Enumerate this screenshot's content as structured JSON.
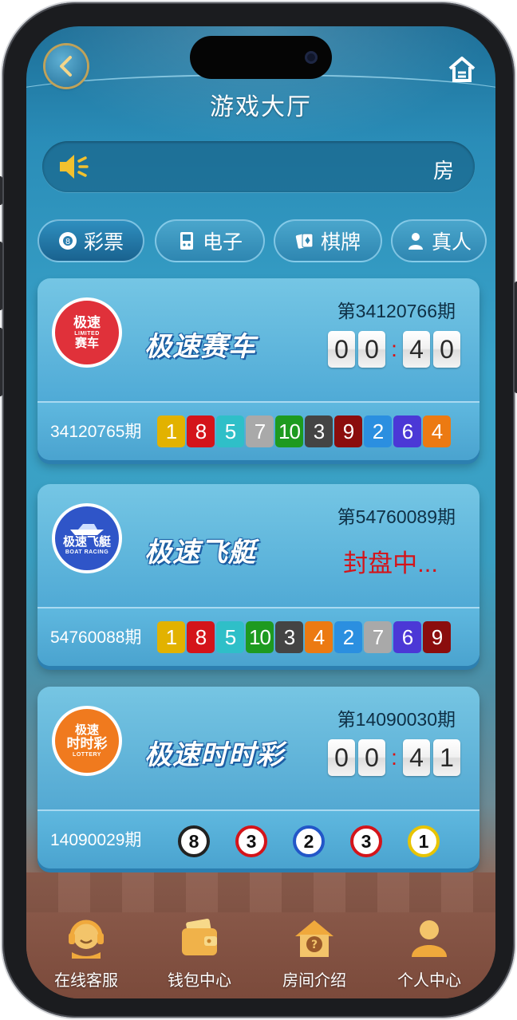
{
  "header": {
    "title": "游戏大厅"
  },
  "notice": {
    "text": "房"
  },
  "tabs": [
    {
      "label": "彩票",
      "icon": "ball-8-icon",
      "active": true
    },
    {
      "label": "电子",
      "icon": "handheld-console-icon"
    },
    {
      "label": "棋牌",
      "icon": "playing-cards-icon"
    },
    {
      "label": "真人",
      "icon": "person-icon"
    }
  ],
  "games": [
    {
      "logo": {
        "l1": "极速",
        "l2": "赛车",
        "l3": "LIMITED",
        "color": "#e0313a"
      },
      "name": "极速赛车",
      "period": "第34120766期",
      "countdown": [
        "0",
        "0",
        "4",
        "0"
      ],
      "last_issue": "34120765期",
      "results": [
        {
          "n": "1",
          "c": "#e2b200"
        },
        {
          "n": "8",
          "c": "#d4141a"
        },
        {
          "n": "5",
          "c": "#2fbfc8"
        },
        {
          "n": "7",
          "c": "#a9a9a9"
        },
        {
          "n": "10",
          "c": "#1e9a20"
        },
        {
          "n": "3",
          "c": "#444444"
        },
        {
          "n": "9",
          "c": "#8b0d0d"
        },
        {
          "n": "2",
          "c": "#2b8fe0"
        },
        {
          "n": "6",
          "c": "#4b38d6"
        },
        {
          "n": "4",
          "c": "#ec7a12"
        }
      ]
    },
    {
      "logo": {
        "l1": "极速飞艇",
        "l2": "",
        "l3": "BOAT RACING",
        "color": "#2f55c8"
      },
      "name": "极速飞艇",
      "period": "第54760089期",
      "status": "封盘中...",
      "last_issue": "54760088期",
      "results": [
        {
          "n": "1",
          "c": "#e2b200"
        },
        {
          "n": "8",
          "c": "#d4141a"
        },
        {
          "n": "5",
          "c": "#2fbfc8"
        },
        {
          "n": "10",
          "c": "#1e9a20"
        },
        {
          "n": "3",
          "c": "#444444"
        },
        {
          "n": "4",
          "c": "#ec7a12"
        },
        {
          "n": "2",
          "c": "#2b8fe0"
        },
        {
          "n": "7",
          "c": "#a9a9a9"
        },
        {
          "n": "6",
          "c": "#4b38d6"
        },
        {
          "n": "9",
          "c": "#8b0d0d"
        }
      ]
    },
    {
      "logo": {
        "l1": "极速",
        "l2": "时时彩",
        "l3": "LOTTERY",
        "color": "#f07a1e"
      },
      "name": "极速时时彩",
      "period": "第14090030期",
      "countdown": [
        "0",
        "0",
        "4",
        "1"
      ],
      "last_issue": "14090029期",
      "balls": [
        {
          "n": "8",
          "c": "#222222"
        },
        {
          "n": "3",
          "c": "#d4141a"
        },
        {
          "n": "2",
          "c": "#2256c8"
        },
        {
          "n": "3",
          "c": "#d4141a"
        },
        {
          "n": "1",
          "c": "#e8c400"
        }
      ]
    }
  ],
  "nav": [
    {
      "label": "在线客服",
      "icon": "headset-support-icon"
    },
    {
      "label": "钱包中心",
      "icon": "wallet-icon"
    },
    {
      "label": "房间介绍",
      "icon": "house-question-icon"
    },
    {
      "label": "个人中心",
      "icon": "user-icon"
    }
  ]
}
